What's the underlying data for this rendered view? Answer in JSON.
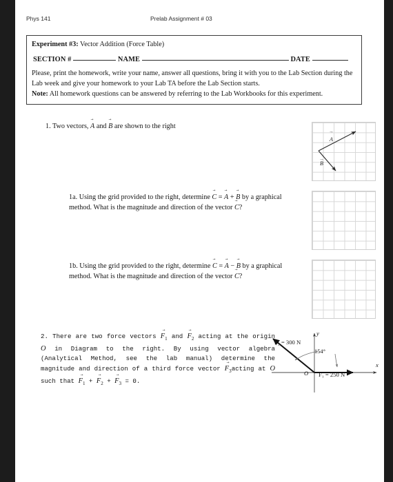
{
  "runhead": {
    "left": "Phys 141",
    "center": "Prelab Assignment # 03"
  },
  "infobox": {
    "experiment_label": "Experiment #3:",
    "experiment_title": " Vector Addition (Force Table)",
    "section_label": "SECTION #",
    "name_label": "NAME",
    "date_label": "DATE",
    "instructions": "Please, print the homework, write your name, answer all questions, bring it with you to the Lab Section during the Lab week and give your homework to your Lab TA before the Lab Section starts.",
    "note_label": "Note:",
    "note_text": " All homework questions can be answered by referring to the Lab Workbooks for this experiment."
  },
  "questions": {
    "q1_number": "1.",
    "q1_text_a": " Two vectors, ",
    "q1_vec_a": "A",
    "q1_text_b": " and ",
    "q1_vec_b": "B",
    "q1_text_c": " are shown to the right",
    "q1a_number": "1a.",
    "q1a_text_a": " Using the grid provided to the right, determine ",
    "q1a_formula_c": "C",
    "q1a_eq": " = ",
    "q1a_formula_a": "A",
    "q1a_op": " + ",
    "q1a_formula_b": "B",
    "q1a_text_b": " by a graphical method. What is the magnitude and direction of the vector ",
    "q1a_formula_c2": "C",
    "q1a_text_c": "?",
    "q1b_number": "1b.",
    "q1b_text_a": " Using the grid provided to the right, determine ",
    "q1b_formula_c": "C",
    "q1b_eq": " = ",
    "q1b_formula_a": "A",
    "q1b_op": " − ",
    "q1b_formula_b": "B",
    "q1b_text_b": " by a graphical method. What is the magnitude and direction of the vector ",
    "q1b_formula_c2": "C",
    "q1b_text_c": "?",
    "q2_number": "2.",
    "q2_part1": " There are two force vectors ",
    "q2_f1": "F",
    "q2_f1_sub": "1",
    "q2_part2": " and ",
    "q2_f2": "F",
    "q2_f2_sub": "2",
    "q2_part3": " acting at the origin ",
    "q2_origin": "O",
    "q2_part4": " in Diagram to the right. By using vector algebra (Analytical Method, see the lab manual) determine the magnitude and direction of a third force vector ",
    "q2_f3": "F",
    "q2_f3_sub": "3",
    "q2_part5": "acting at ",
    "q2_origin2": "O",
    "q2_part6": " such that ",
    "q2_eq_f1": "F",
    "q2_eq_f1_sub": "1",
    "q2_eq_plus1": " + ",
    "q2_eq_f2": "F",
    "q2_eq_f2_sub": "2",
    "q2_eq_plus2": " + ",
    "q2_eq_f3": "F",
    "q2_eq_f3_sub": "3",
    "q2_eq_end": " = 0."
  },
  "grid_vectors": {
    "label_a": "A",
    "label_b": "B"
  },
  "diagram": {
    "label_f2": "F₂ = 300 N",
    "label_f1": "F₁ = 250 N",
    "label_angle": "154°",
    "label_origin": "O",
    "label_x_axis": "x",
    "label_y_axis": "y",
    "f1_magnitude": "250 N",
    "f2_magnitude": "300 N",
    "angle_value": "154°"
  },
  "colors": {
    "page_background": "#ffffff",
    "outside_background": "#1c1c1c",
    "text": "#151515",
    "box_border": "#3a3a3a",
    "grid_line": "#d8d8d8",
    "vector_stroke": "#2b2b2b"
  }
}
